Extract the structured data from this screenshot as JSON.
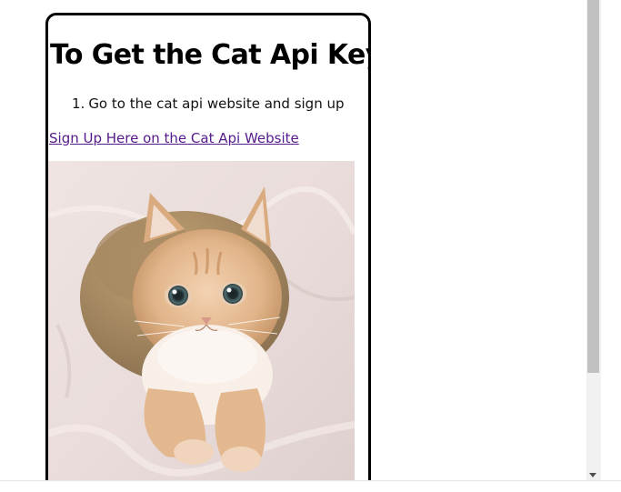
{
  "page": {
    "title": "To Get the Cat Api Key",
    "steps": [
      {
        "number": "1.",
        "text": "Go to the cat api website and sign up"
      }
    ],
    "link_text": "Sign Up Here on the Cat Api Website",
    "image_alt": "cat photo"
  },
  "colors": {
    "link": "#551a8b",
    "card_border": "#000000",
    "scroll_thumb": "#c1c1c1"
  },
  "icons": {
    "scroll_down": "triangle-down-icon"
  }
}
